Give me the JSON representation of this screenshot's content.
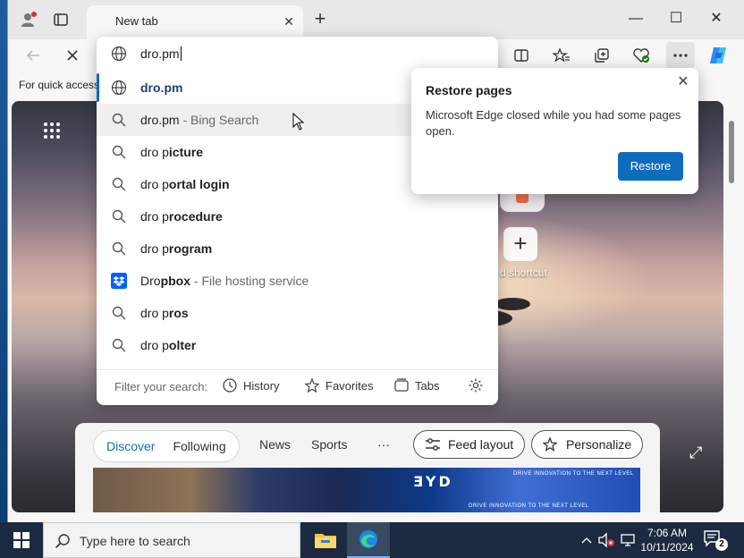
{
  "browser": {
    "tab": {
      "title": "New tab",
      "close_glyph": "✕"
    },
    "newtab_glyph": "+",
    "window_controls": {
      "minimize": "—",
      "maximize": "☐",
      "close": "✕"
    },
    "favorites_bar_text": "For quick access",
    "address_value": "dro.pm"
  },
  "suggestions": [
    {
      "icon": "globe-icon",
      "pre": "",
      "bold": "dro.pm",
      "post": "",
      "sub": ""
    },
    {
      "icon": "search-icon",
      "pre": "dro.pm",
      "bold": "",
      "post": "",
      "sub": " - Bing Search"
    },
    {
      "icon": "search-icon",
      "pre": "dro p",
      "bold": "icture",
      "post": "",
      "sub": ""
    },
    {
      "icon": "search-icon",
      "pre": "dro p",
      "bold": "ortal login",
      "post": "",
      "sub": ""
    },
    {
      "icon": "search-icon",
      "pre": "dro p",
      "bold": "rocedure",
      "post": "",
      "sub": ""
    },
    {
      "icon": "search-icon",
      "pre": "dro p",
      "bold": "rogram",
      "post": "",
      "sub": ""
    },
    {
      "icon": "dropbox-icon",
      "pre": "Dro",
      "bold": "pbox",
      "post": "",
      "sub": " - File hosting service"
    },
    {
      "icon": "search-icon",
      "pre": "dro p",
      "bold": "ros",
      "post": "",
      "sub": ""
    },
    {
      "icon": "search-icon",
      "pre": "dro p",
      "bold": "olter",
      "post": "",
      "sub": ""
    }
  ],
  "filter": {
    "label": "Filter your search:",
    "history": "History",
    "favorites": "Favorites",
    "tabs": "Tabs"
  },
  "popup": {
    "title": "Restore pages",
    "message": "Microsoft Edge closed while you had some pages open.",
    "button": "Restore",
    "close_glyph": "✕"
  },
  "ntp": {
    "add_shortcut_label": "d shortcut",
    "add_glyph": "+",
    "expand_glyph": "⤢",
    "feed_tabs": [
      "Discover",
      "Following"
    ],
    "feed_links": [
      "News",
      "Sports"
    ],
    "more_glyph": "···",
    "feed_layout": "Feed layout",
    "personalize": "Personalize",
    "ad_logo": "ƎYD",
    "ad_tagline_1": "DRIVE INNOVATION TO THE NEXT LEVEL",
    "ad_tagline_2": "DRIVE INNOVATION TO THE NEXT LEVEL"
  },
  "taskbar": {
    "search_placeholder": "Type here to search",
    "time": "7:06 AM",
    "date": "10/11/2024",
    "notification_count": "2"
  },
  "colors": {
    "accent": "#0f6cbd",
    "taskbar": "#1b2a40",
    "dropbox": "#0061fe"
  }
}
